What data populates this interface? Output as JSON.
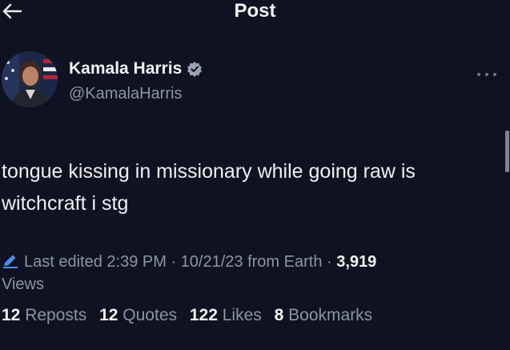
{
  "header": {
    "title": "Post"
  },
  "author": {
    "name": "Kamala Harris",
    "handle": "@KamalaHarris"
  },
  "tweet": {
    "line1": "tongue kissing in missionary while going raw is",
    "line2": "witchcraft i stg"
  },
  "meta": {
    "edited": "Last edited 2:39 PM · 10/21/23",
    "location": "from Earth ·",
    "views_count": "3,919",
    "views_label": "Views"
  },
  "stats": {
    "reposts_count": "12",
    "reposts_label": "Reposts",
    "quotes_count": "12",
    "quotes_label": "Quotes",
    "likes_count": "122",
    "likes_label": "Likes",
    "bookmarks_count": "8",
    "bookmarks_label": "Bookmarks"
  },
  "icons": {
    "back": "arrow-left-icon",
    "verified": "verified-badge-icon",
    "more": "more-horizontal-icon",
    "edit": "pencil-icon"
  },
  "colors": {
    "background": "#0f1220",
    "text_primary": "#f2f3f5",
    "text_secondary": "#8b95a3",
    "edit_accent": "#4a8ef0"
  }
}
